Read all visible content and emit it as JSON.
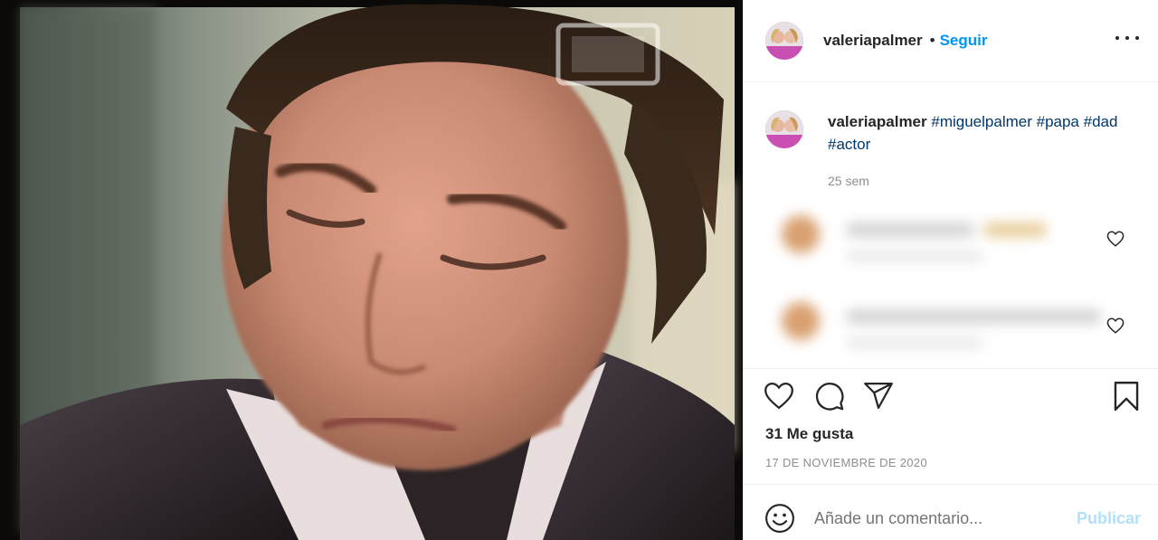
{
  "post": {
    "username": "valeriapalmer",
    "separator": "•",
    "follow_label": "Seguir",
    "more_icon": "more-horizontal-icon"
  },
  "caption": {
    "username": "valeriapalmer",
    "hashtags": [
      "#miguelpalmer",
      "#papa",
      "#dad",
      "#actor"
    ],
    "time": "25 sem"
  },
  "comments": [
    {
      "state": "blurred",
      "icon": "heart-outline-icon"
    },
    {
      "state": "blurred",
      "icon": "heart-outline-icon"
    }
  ],
  "actions": {
    "like_icon": "heart-outline-icon",
    "comment_icon": "comment-bubble-icon",
    "share_icon": "paper-plane-icon",
    "save_icon": "bookmark-icon"
  },
  "stats": {
    "likes_text": "31 Me gusta",
    "date_text": "17 DE NOVIEMBRE DE 2020"
  },
  "compose": {
    "emoji_icon": "smiley-face-icon",
    "placeholder": "Añade un comentario...",
    "publish_label": "Publicar"
  },
  "colors": {
    "link_blue": "#0095f6",
    "hashtag": "#00376b",
    "publish_disabled": "#b2dffc",
    "muted": "#8e8e8e"
  }
}
